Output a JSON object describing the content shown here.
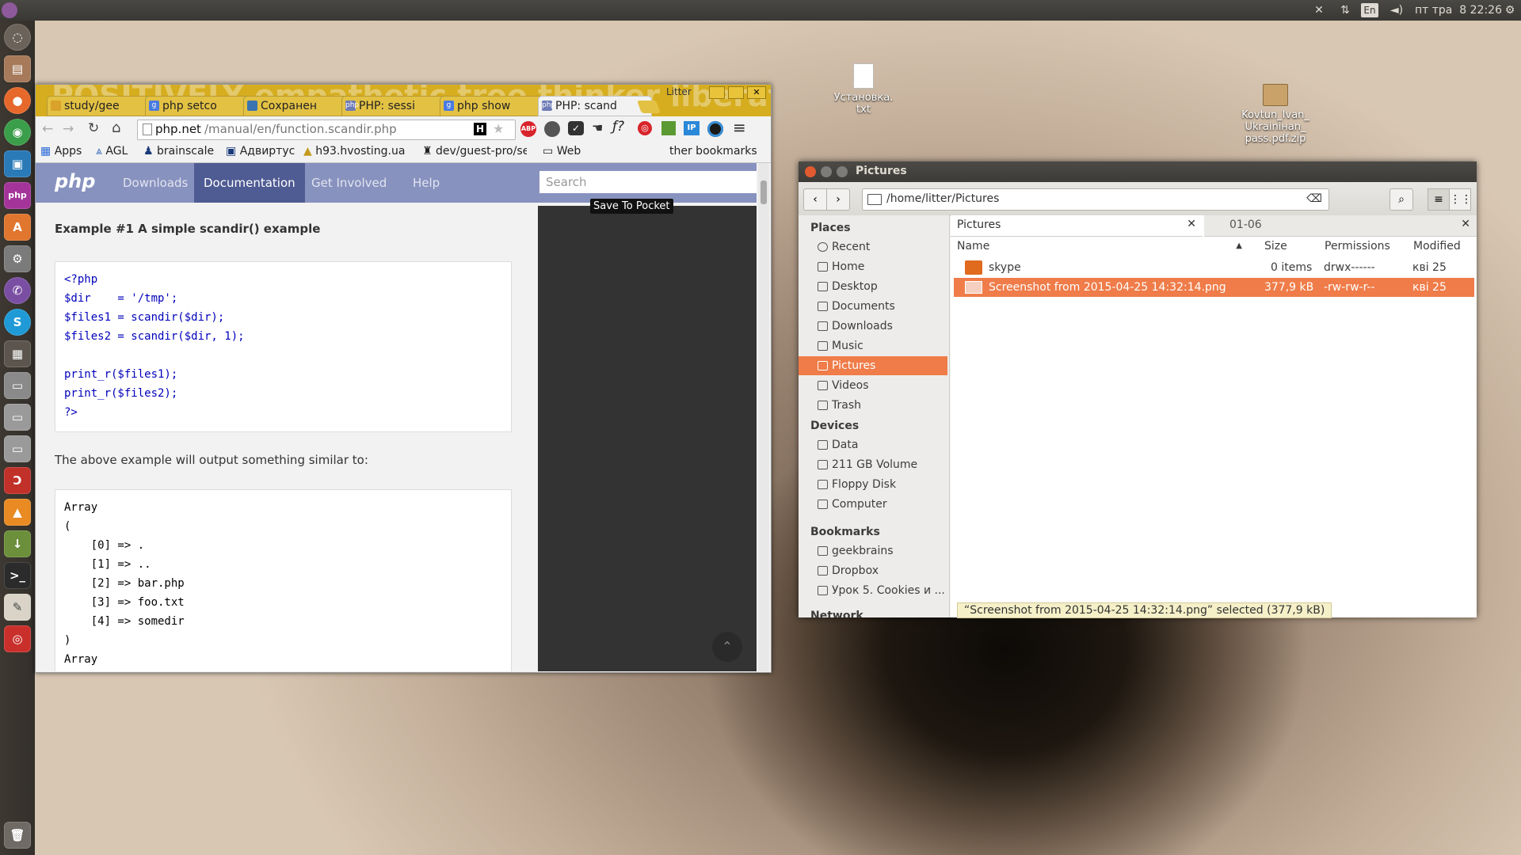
{
  "top_panel": {
    "keyboard_layout": "En",
    "datetime": "пт тра  8 22:26"
  },
  "desktop_icons": [
    {
      "label_line1": "Установка.",
      "label_line2": "txt"
    },
    {
      "label_line1": "Kovtun_Ivan_",
      "label_line2": "Ukrainiнan_",
      "label_line3": "pass.pdf.zip"
    }
  ],
  "browser": {
    "window_user": "Litter",
    "tabs": [
      {
        "label": "study/gee",
        "icon": "folder-icon"
      },
      {
        "label": "php setco",
        "icon": "google-icon"
      },
      {
        "label": "Сохранен",
        "icon": "python-icon"
      },
      {
        "label": "PHP: sessi",
        "icon": "php-icon"
      },
      {
        "label": "php show",
        "icon": "google-icon"
      },
      {
        "label": "PHP: scand",
        "icon": "php-icon"
      }
    ],
    "url_host": "php.net",
    "url_path": "/manual/en/function.scandir.php",
    "bookmarks": [
      "Apps",
      "AGL",
      "brainscale",
      "Адвиртус",
      "h93.hvosting.ua",
      "dev/guest-pro/se",
      "Web",
      "Other bookmarks"
    ],
    "bookmark_other_visible": "ther bookmarks",
    "pocket_tooltip": "Save To Pocket",
    "php_nav": {
      "logo": "php",
      "items": [
        "Downloads",
        "Documentation",
        "Get Involved",
        "Help"
      ],
      "search_placeholder": "Search"
    },
    "example_title": "Example #1 A simple scandir() example",
    "code_lines": [
      "<?php",
      "$dir    = '/tmp';",
      "$files1 = scandir($dir);",
      "$files2 = scandir($dir, 1);",
      "",
      "print_r($files1);",
      "print_r($files2);",
      "?>"
    ],
    "output_intro": "The above example will output something similar to:",
    "output_lines": [
      "Array",
      "(",
      "    [0] => .",
      "    [1] => ..",
      "    [2] => bar.php",
      "    [3] => foo.txt",
      "    [4] => somedir",
      ")",
      "Array"
    ]
  },
  "file_manager": {
    "title": "Pictures",
    "path": "/home/litter/Pictures",
    "tabs": [
      "Pictures",
      "01-06"
    ],
    "sidebar": {
      "places_header": "Places",
      "places": [
        "Recent",
        "Home",
        "Desktop",
        "Documents",
        "Downloads",
        "Music",
        "Pictures",
        "Videos",
        "Trash"
      ],
      "devices_header": "Devices",
      "devices": [
        "Data",
        "211 GB Volume",
        "Floppy Disk",
        "Computer"
      ],
      "bookmarks_header": "Bookmarks",
      "bookmarks": [
        "geekbrains",
        "Dropbox",
        "Урок 5. Cookies и ..."
      ],
      "network_header": "Network"
    },
    "columns": [
      "Name",
      "Size",
      "Permissions",
      "Modified"
    ],
    "rows": [
      {
        "name": "skype",
        "size": "0 items",
        "permissions": "drwx------",
        "modified": "кві 25"
      },
      {
        "name": "Screenshot from 2015-04-25 14:32:14.png",
        "size": "377,9 kB",
        "permissions": "-rw-rw-r--",
        "modified": "кві 25"
      }
    ],
    "status": "“Screenshot from 2015-04-25 14:32:14.png” selected  (377,9 kB)"
  }
}
